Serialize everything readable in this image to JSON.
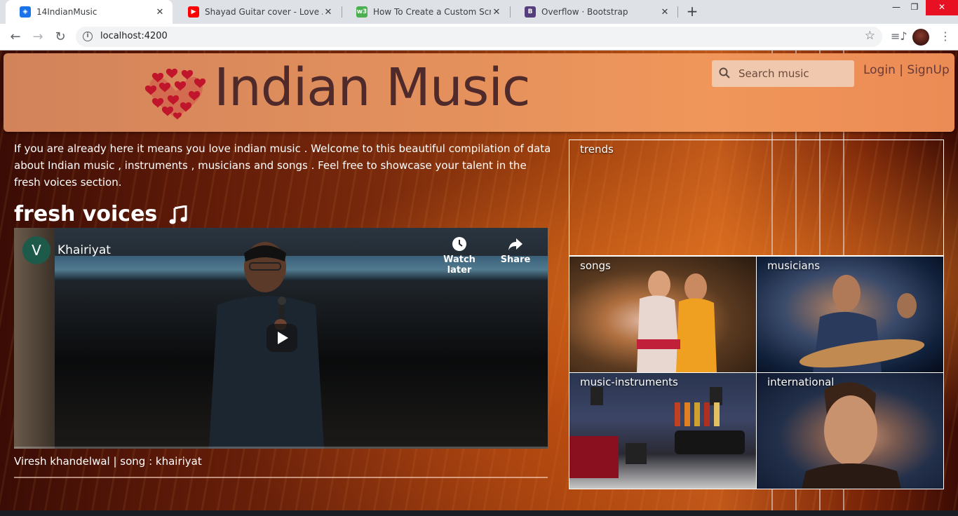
{
  "browser": {
    "tabs": [
      {
        "title": "14IndianMusic",
        "active": true,
        "favicon_color": "#1a73e8"
      },
      {
        "title": "Shayad Guitar cover - Love Aaj K",
        "active": false,
        "favicon_color": "#ff0000"
      },
      {
        "title": "How To Create a Custom Scrollb",
        "active": false,
        "favicon_color": "#4caf50"
      },
      {
        "title": "Overflow · Bootstrap",
        "active": false,
        "favicon_color": "#563d7c"
      }
    ],
    "url": "localhost:4200"
  },
  "header": {
    "brand": "Indian Music",
    "search_placeholder": "Search music",
    "login": "Login",
    "separator": "|",
    "signup": "SignUp"
  },
  "main": {
    "intro": "If you are already here it means you love indian music . Welcome to this beautiful compilation of data about Indian music , instruments , musicians and songs . Feel free to showcase your talent in the fresh voices section.",
    "fresh_title": "fresh voices",
    "video": {
      "channel_initial": "V",
      "title": "Khairiyat",
      "watch_later": "Watch later",
      "share": "Share"
    },
    "caption": "Viresh khandelwal | song : khairiyat"
  },
  "categories": [
    {
      "label": "trends"
    },
    {
      "label": "songs"
    },
    {
      "label": "musicians"
    },
    {
      "label": "music-instruments"
    },
    {
      "label": "international"
    }
  ],
  "colors": {
    "header_bg": "#e18f5d",
    "brand_text": "#4f2a2a",
    "heart": "#c0152a"
  }
}
